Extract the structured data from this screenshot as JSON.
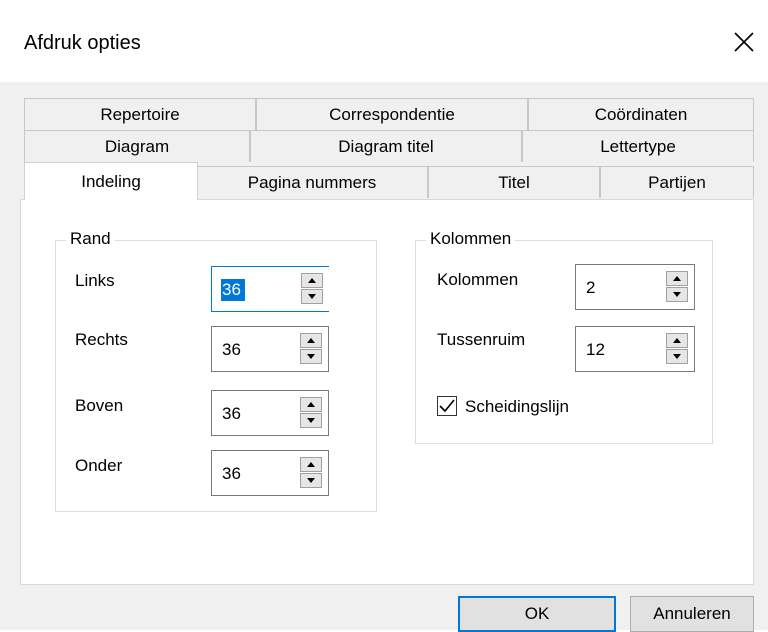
{
  "window": {
    "title": "Afdruk opties"
  },
  "tabs": {
    "row1": [
      "Repertoire",
      "Correspondentie",
      "Coördinaten"
    ],
    "row2": [
      "Diagram",
      "Diagram titel",
      "Lettertype"
    ],
    "row3": [
      "Indeling",
      "Pagina nummers",
      "Titel",
      "Partijen"
    ],
    "active": "Indeling"
  },
  "rand": {
    "legend": "Rand",
    "fields": [
      {
        "label": "Links",
        "value": "36"
      },
      {
        "label": "Rechts",
        "value": "36"
      },
      {
        "label": "Boven",
        "value": "36"
      },
      {
        "label": "Onder",
        "value": "36"
      }
    ]
  },
  "kolommen": {
    "legend": "Kolommen",
    "fields": [
      {
        "label": "Kolommen",
        "value": "2"
      },
      {
        "label": "Tussenruim",
        "value": "12"
      }
    ],
    "checkbox": {
      "label": "Scheidingslijn",
      "checked": true
    }
  },
  "buttons": {
    "ok": "OK",
    "cancel": "Annuleren"
  },
  "colors": {
    "accent": "#0078d7",
    "dialog_bg": "#f0f0f0",
    "panel_bg": "#ffffff"
  },
  "icons": {
    "close": "close-icon",
    "spin_up": "arrow-up-icon",
    "spin_down": "arrow-down-icon",
    "check": "checkmark-icon"
  }
}
